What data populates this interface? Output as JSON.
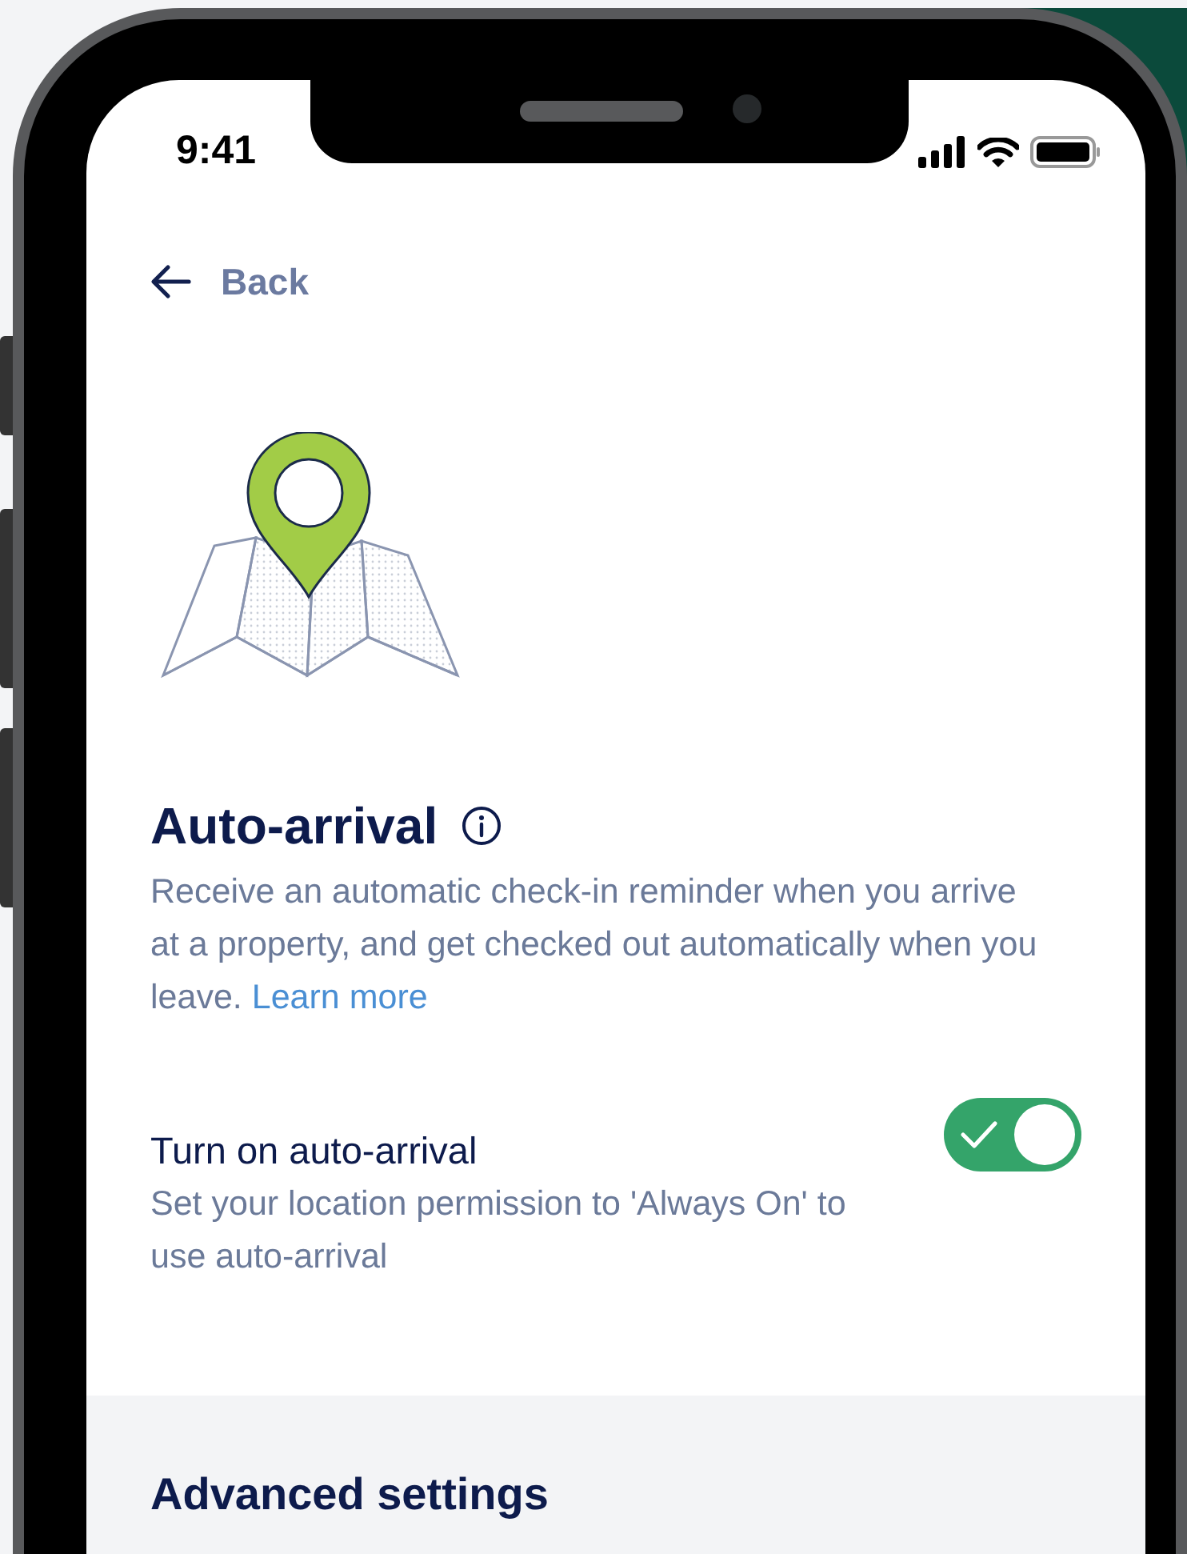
{
  "status_bar": {
    "time": "9:41"
  },
  "back": {
    "label": "Back"
  },
  "feature": {
    "title": "Auto-arrival",
    "description": "Receive an automatic check-in reminder when you arrive at a property, and get checked out automatically when you leave.",
    "link": "Learn more"
  },
  "toggle": {
    "label": "Turn on auto-arrival",
    "description": "Set your location permission to 'Always On' to use auto-arrival",
    "on": true
  },
  "advanced": {
    "title": "Advanced settings"
  }
}
